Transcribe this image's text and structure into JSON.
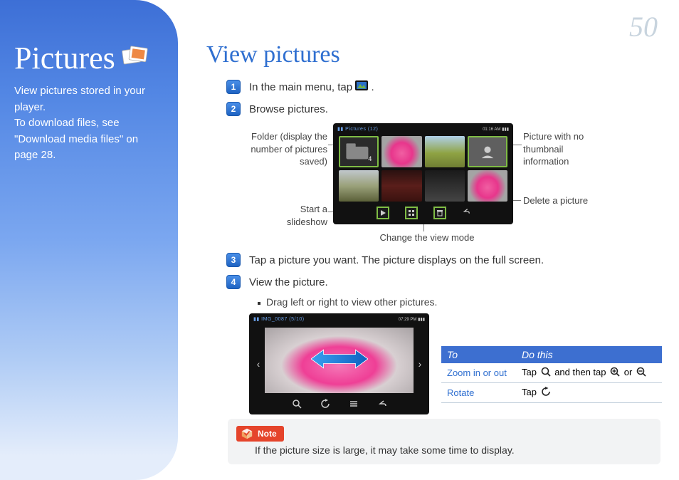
{
  "page_number": "50",
  "sidebar": {
    "title": "Pictures",
    "description": "View pictures stored in your player.\nTo download files, see \"Download media files\" on page 28."
  },
  "main": {
    "heading": "View pictures",
    "steps": {
      "s1a": "In the main menu, tap ",
      "s1b": ".",
      "s2": "Browse pictures.",
      "s3": "Tap a picture you want. The picture displays on the full screen.",
      "s4": "View the picture.",
      "s4_sub": "Drag left or right to view other pictures."
    }
  },
  "screen1": {
    "topbar_left": "Pictures (12)",
    "topbar_right": "01:16 AM",
    "callouts": {
      "folder": "Folder (display the number of pictures saved)",
      "slideshow": "Start a slideshow",
      "no_thumb": "Picture with no thumbnail information",
      "delete": "Delete a picture",
      "view_mode": "Change the view mode"
    }
  },
  "screen2": {
    "topbar_left": "IMG_0087 (5/10)",
    "topbar_right": "07:29 PM"
  },
  "table": {
    "headers": {
      "to": "To",
      "do": "Do this"
    },
    "rows": {
      "r1_to": "Zoom in or out",
      "r1_a": "Tap ",
      "r1_b": " and then tap ",
      "r1_c": " or ",
      "r2_to": "Rotate",
      "r2_a": "Tap "
    }
  },
  "note": {
    "label": "Note",
    "text": "If the picture size is large, it may take some time to display."
  }
}
